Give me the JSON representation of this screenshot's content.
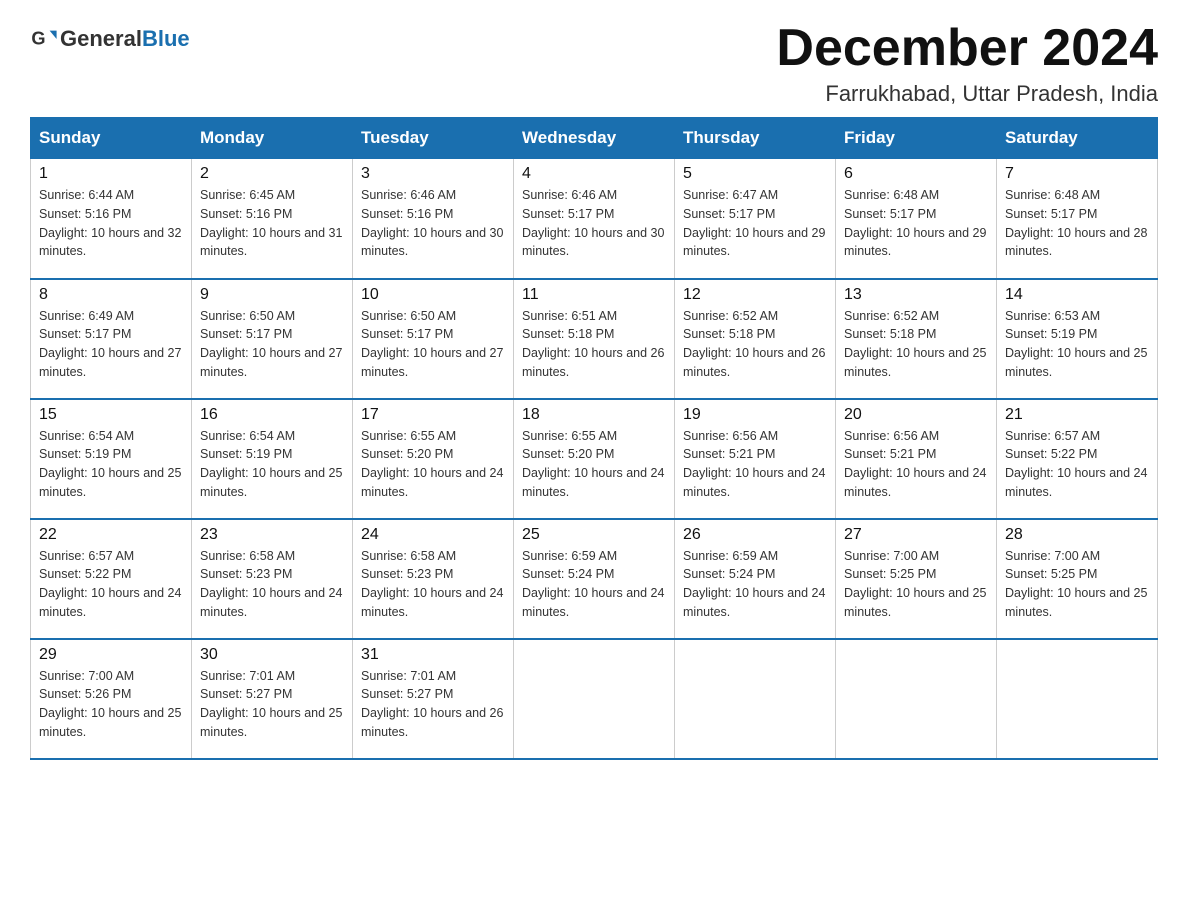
{
  "header": {
    "logo_text_general": "General",
    "logo_text_blue": "Blue",
    "title": "December 2024",
    "subtitle": "Farrukhabad, Uttar Pradesh, India"
  },
  "weekdays": [
    "Sunday",
    "Monday",
    "Tuesday",
    "Wednesday",
    "Thursday",
    "Friday",
    "Saturday"
  ],
  "weeks": [
    [
      {
        "day": "1",
        "sunrise": "6:44 AM",
        "sunset": "5:16 PM",
        "daylight": "10 hours and 32 minutes."
      },
      {
        "day": "2",
        "sunrise": "6:45 AM",
        "sunset": "5:16 PM",
        "daylight": "10 hours and 31 minutes."
      },
      {
        "day": "3",
        "sunrise": "6:46 AM",
        "sunset": "5:16 PM",
        "daylight": "10 hours and 30 minutes."
      },
      {
        "day": "4",
        "sunrise": "6:46 AM",
        "sunset": "5:17 PM",
        "daylight": "10 hours and 30 minutes."
      },
      {
        "day": "5",
        "sunrise": "6:47 AM",
        "sunset": "5:17 PM",
        "daylight": "10 hours and 29 minutes."
      },
      {
        "day": "6",
        "sunrise": "6:48 AM",
        "sunset": "5:17 PM",
        "daylight": "10 hours and 29 minutes."
      },
      {
        "day": "7",
        "sunrise": "6:48 AM",
        "sunset": "5:17 PM",
        "daylight": "10 hours and 28 minutes."
      }
    ],
    [
      {
        "day": "8",
        "sunrise": "6:49 AM",
        "sunset": "5:17 PM",
        "daylight": "10 hours and 27 minutes."
      },
      {
        "day": "9",
        "sunrise": "6:50 AM",
        "sunset": "5:17 PM",
        "daylight": "10 hours and 27 minutes."
      },
      {
        "day": "10",
        "sunrise": "6:50 AM",
        "sunset": "5:17 PM",
        "daylight": "10 hours and 27 minutes."
      },
      {
        "day": "11",
        "sunrise": "6:51 AM",
        "sunset": "5:18 PM",
        "daylight": "10 hours and 26 minutes."
      },
      {
        "day": "12",
        "sunrise": "6:52 AM",
        "sunset": "5:18 PM",
        "daylight": "10 hours and 26 minutes."
      },
      {
        "day": "13",
        "sunrise": "6:52 AM",
        "sunset": "5:18 PM",
        "daylight": "10 hours and 25 minutes."
      },
      {
        "day": "14",
        "sunrise": "6:53 AM",
        "sunset": "5:19 PM",
        "daylight": "10 hours and 25 minutes."
      }
    ],
    [
      {
        "day": "15",
        "sunrise": "6:54 AM",
        "sunset": "5:19 PM",
        "daylight": "10 hours and 25 minutes."
      },
      {
        "day": "16",
        "sunrise": "6:54 AM",
        "sunset": "5:19 PM",
        "daylight": "10 hours and 25 minutes."
      },
      {
        "day": "17",
        "sunrise": "6:55 AM",
        "sunset": "5:20 PM",
        "daylight": "10 hours and 24 minutes."
      },
      {
        "day": "18",
        "sunrise": "6:55 AM",
        "sunset": "5:20 PM",
        "daylight": "10 hours and 24 minutes."
      },
      {
        "day": "19",
        "sunrise": "6:56 AM",
        "sunset": "5:21 PM",
        "daylight": "10 hours and 24 minutes."
      },
      {
        "day": "20",
        "sunrise": "6:56 AM",
        "sunset": "5:21 PM",
        "daylight": "10 hours and 24 minutes."
      },
      {
        "day": "21",
        "sunrise": "6:57 AM",
        "sunset": "5:22 PM",
        "daylight": "10 hours and 24 minutes."
      }
    ],
    [
      {
        "day": "22",
        "sunrise": "6:57 AM",
        "sunset": "5:22 PM",
        "daylight": "10 hours and 24 minutes."
      },
      {
        "day": "23",
        "sunrise": "6:58 AM",
        "sunset": "5:23 PM",
        "daylight": "10 hours and 24 minutes."
      },
      {
        "day": "24",
        "sunrise": "6:58 AM",
        "sunset": "5:23 PM",
        "daylight": "10 hours and 24 minutes."
      },
      {
        "day": "25",
        "sunrise": "6:59 AM",
        "sunset": "5:24 PM",
        "daylight": "10 hours and 24 minutes."
      },
      {
        "day": "26",
        "sunrise": "6:59 AM",
        "sunset": "5:24 PM",
        "daylight": "10 hours and 24 minutes."
      },
      {
        "day": "27",
        "sunrise": "7:00 AM",
        "sunset": "5:25 PM",
        "daylight": "10 hours and 25 minutes."
      },
      {
        "day": "28",
        "sunrise": "7:00 AM",
        "sunset": "5:25 PM",
        "daylight": "10 hours and 25 minutes."
      }
    ],
    [
      {
        "day": "29",
        "sunrise": "7:00 AM",
        "sunset": "5:26 PM",
        "daylight": "10 hours and 25 minutes."
      },
      {
        "day": "30",
        "sunrise": "7:01 AM",
        "sunset": "5:27 PM",
        "daylight": "10 hours and 25 minutes."
      },
      {
        "day": "31",
        "sunrise": "7:01 AM",
        "sunset": "5:27 PM",
        "daylight": "10 hours and 26 minutes."
      },
      null,
      null,
      null,
      null
    ]
  ]
}
